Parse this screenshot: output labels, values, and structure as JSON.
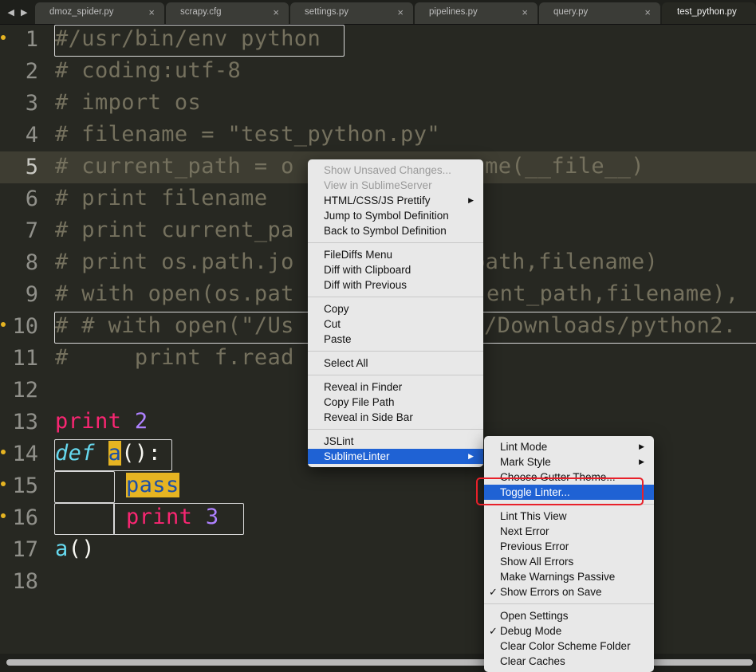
{
  "tabs": [
    {
      "label": "dmoz_spider.py"
    },
    {
      "label": "scrapy.cfg"
    },
    {
      "label": "settings.py"
    },
    {
      "label": "pipelines.py"
    },
    {
      "label": "query.py"
    },
    {
      "label": "test_python.py"
    }
  ],
  "editor": {
    "lines": [
      {
        "n": "1",
        "parts": [
          "#/usr/bin/env python"
        ]
      },
      {
        "n": "2",
        "parts": [
          "# coding:utf-8"
        ]
      },
      {
        "n": "3",
        "parts": [
          "# import os"
        ]
      },
      {
        "n": "4",
        "parts": [
          "# filename = \"test_python.py\""
        ]
      },
      {
        "n": "5",
        "parts": [
          "# current_path = ",
          "o",
          ".path.dirname(__file__)",
          " ame(__file__)"
        ]
      },
      {
        "n": "6",
        "parts": [
          "# print filename"
        ]
      },
      {
        "n": "7",
        "parts": [
          "# print current_pa"
        ]
      },
      {
        "n": "8",
        "parts": [
          "# print os.path.jo",
          "path,filename)"
        ]
      },
      {
        "n": "9",
        "parts": [
          "# with open(os.pat",
          "ent_path,filename),"
        ]
      },
      {
        "n": "10",
        "parts": [
          "# # with open(\"/Us",
          "/Downloads/python2."
        ]
      },
      {
        "n": "11",
        "parts": [
          "#     print f.read"
        ]
      },
      {
        "n": "12",
        "parts": [
          ""
        ]
      },
      {
        "n": "13",
        "parts": [
          "print",
          " 2"
        ]
      },
      {
        "n": "14",
        "parts": [
          "def",
          " ",
          "a",
          "():"
        ]
      },
      {
        "n": "15",
        "parts": [
          "        ",
          "pass"
        ]
      },
      {
        "n": "16",
        "parts": [
          "        ",
          "print",
          " 3"
        ]
      },
      {
        "n": "17",
        "parts": [
          "a",
          "()"
        ]
      },
      {
        "n": "18",
        "parts": [
          ""
        ]
      }
    ]
  },
  "context_menu": {
    "items": [
      "Show Unsaved Changes...",
      "View in SublimeServer",
      "HTML/CSS/JS Prettify",
      "Jump to Symbol Definition",
      "Back to Symbol Definition",
      "FileDiffs Menu",
      "Diff with Clipboard",
      "Diff with Previous",
      "Copy",
      "Cut",
      "Paste",
      "Select All",
      "Reveal in Finder",
      "Copy File Path",
      "Reveal in Side Bar",
      "JSLint",
      "SublimeLinter"
    ]
  },
  "submenu": {
    "items": [
      "Lint Mode",
      "Mark Style",
      "Choose Gutter Theme...",
      "Toggle Linter...",
      "Lint This View",
      "Next Error",
      "Previous Error",
      "Show All Errors",
      "Make Warnings Passive",
      "Show Errors on Save",
      "Open Settings",
      "Debug Mode",
      "Clear Color Scheme Folder",
      "Clear Caches"
    ]
  },
  "icons": {
    "nav_left": "◀",
    "nav_right": "▶",
    "close": "×",
    "submenu_arrow": "▶",
    "check": "✓"
  },
  "colors": {
    "editor_bg": "#272822",
    "comment": "#75715e",
    "keyword": "#f92672",
    "number": "#ae81ff",
    "selection_blue": "#1f62d4",
    "highlight_annotation": "#e8202a"
  }
}
